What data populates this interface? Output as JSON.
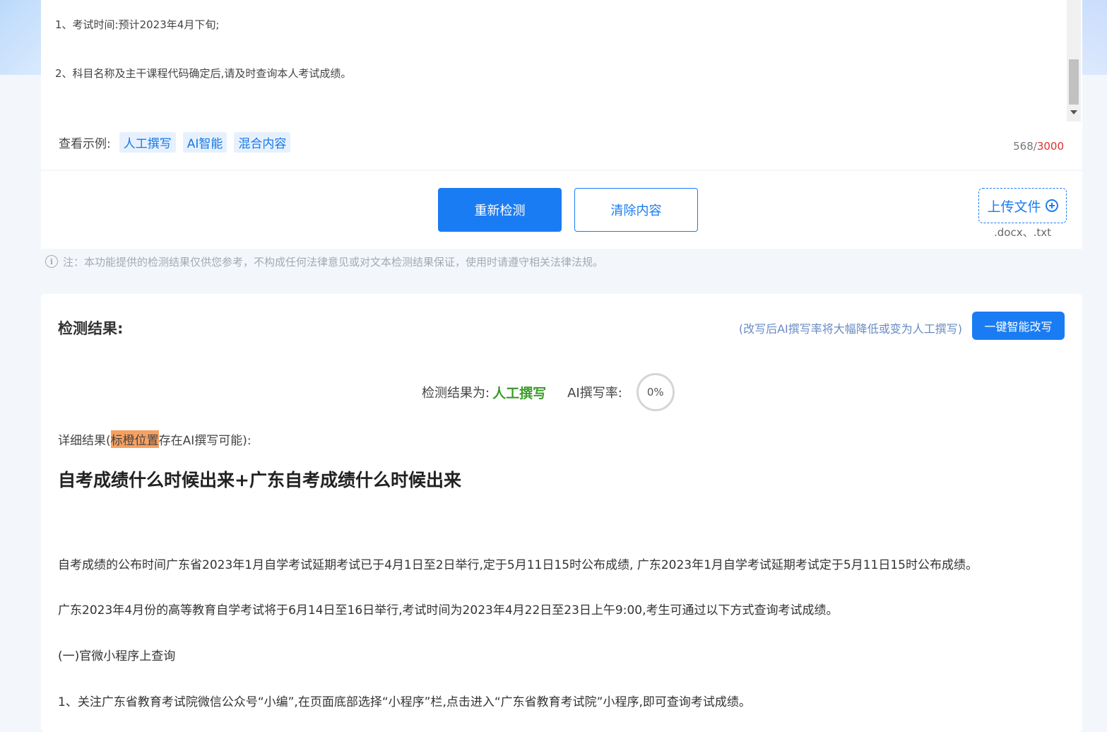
{
  "input": {
    "line1": "1、考试时间:预计2023年4月下旬;",
    "line2": "2、科目名称及主干课程代码确定后,请及时查询本人考试成绩。",
    "examples_label": "查看示例:",
    "examples": [
      "人工撰写",
      "AI智能",
      "混合内容"
    ],
    "count_current": "568",
    "count_separator": "/",
    "count_max": "3000"
  },
  "actions": {
    "recheck_label": "重新检测",
    "clear_label": "清除内容",
    "upload_label": "上传文件",
    "upload_formats": ".docx、.txt"
  },
  "note": {
    "icon": "i",
    "text": "注：本功能提供的检测结果仅供您参考，不构成任何法律意见或对文本检测结果保证，使用时请遵守相关法律法规。"
  },
  "result": {
    "title": "检测结果:",
    "rewrite_hint": "(改写后AI撰写率将大幅降低或变为人工撰写)",
    "rewrite_button": "一键智能改写",
    "verdict_label": "检测结果为:",
    "verdict_value": "人工撰写",
    "rate_label": "AI撰写率:",
    "rate_value": "0%",
    "detail_prefix": "详细结果(",
    "detail_highlight": "标橙位置",
    "detail_suffix": "存在AI撰写可能):",
    "article_title": "自考成绩什么时候出来+广东自考成绩什么时候出来",
    "paragraphs": [
      "自考成绩的公布时间广东省2023年1月自学考试延期考试已于4月1日至2日举行,定于5月11日15时公布成绩, 广东2023年1月自学考试延期考试定于5月11日15时公布成绩。",
      "广东2023年4月份的高等教育自学考试将于6月14日至16日举行,考试时间为2023年4月22日至23日上午9:00,考生可通过以下方式查询考试成绩。",
      "(一)官微小程序上查询",
      "1、关注广东省教育考试院微信公众号“小编”,在页面底部选择“小程序”栏,点击进入“广东省教育考试院”小程序,即可查询考试成绩。"
    ]
  },
  "colors": {
    "primary": "#1a7cf3",
    "verdict_green": "#3c9b28",
    "highlight_orange": "#f6a162",
    "count_red": "#e0322c"
  }
}
